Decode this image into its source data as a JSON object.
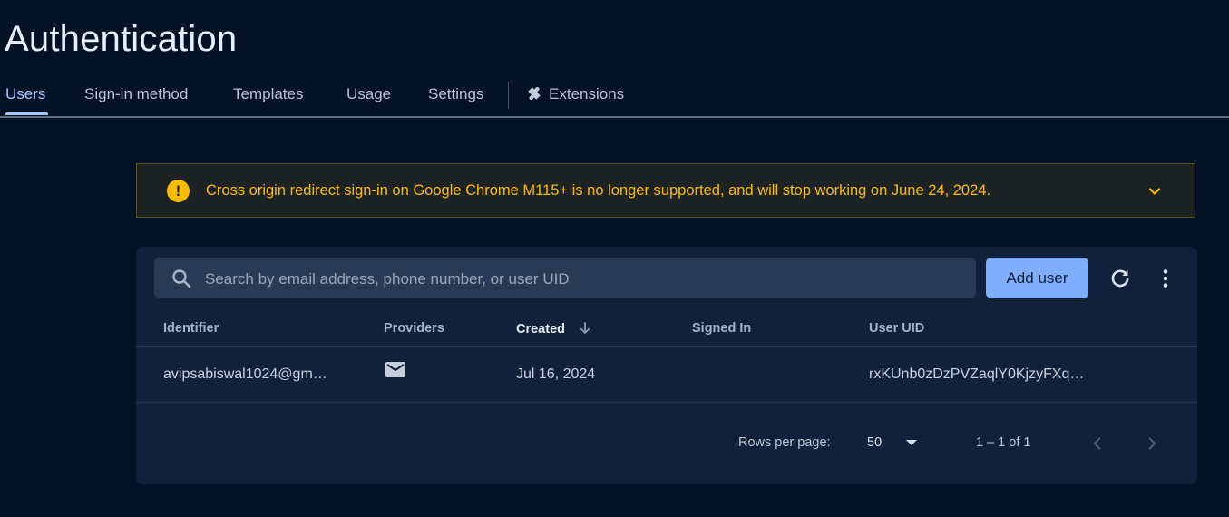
{
  "page": {
    "title": "Authentication"
  },
  "tabs": [
    {
      "label": "Users",
      "active": true
    },
    {
      "label": "Sign-in method",
      "active": false
    },
    {
      "label": "Templates",
      "active": false
    },
    {
      "label": "Usage",
      "active": false
    },
    {
      "label": "Settings",
      "active": false
    },
    {
      "label": "Extensions",
      "active": false,
      "icon": "extensions-icon"
    }
  ],
  "banner": {
    "icon": "warning-icon",
    "text": "Cross origin redirect sign-in on Google Chrome M115+ is no longer supported, and will stop working on June 24, 2024.",
    "expand_icon": "chevron-down-icon",
    "color": "#fbbc04"
  },
  "users_table": {
    "search": {
      "placeholder": "Search by email address, phone number, or user UID",
      "value": ""
    },
    "add_user_label": "Add user",
    "columns": [
      "Identifier",
      "Providers",
      "Created",
      "Signed In",
      "User UID"
    ],
    "sorted_column": "Created",
    "sort_direction": "descending",
    "rows": [
      {
        "identifier": "avipsabiswal1024@gm…",
        "provider_icon": "email-icon",
        "created": "Jul 16, 2024",
        "signed_in": "",
        "user_uid": "rxKUnb0zDzPVZaqlY0KjzyFXq…"
      }
    ],
    "footer": {
      "rows_per_page_label": "Rows per page:",
      "rows_per_page_value": "50",
      "range_text": "1 – 1 of 1"
    }
  },
  "colors": {
    "background": "#041225",
    "card": "#112139",
    "accent": "#a9c7ff",
    "primary_button": "#7eaefc"
  }
}
